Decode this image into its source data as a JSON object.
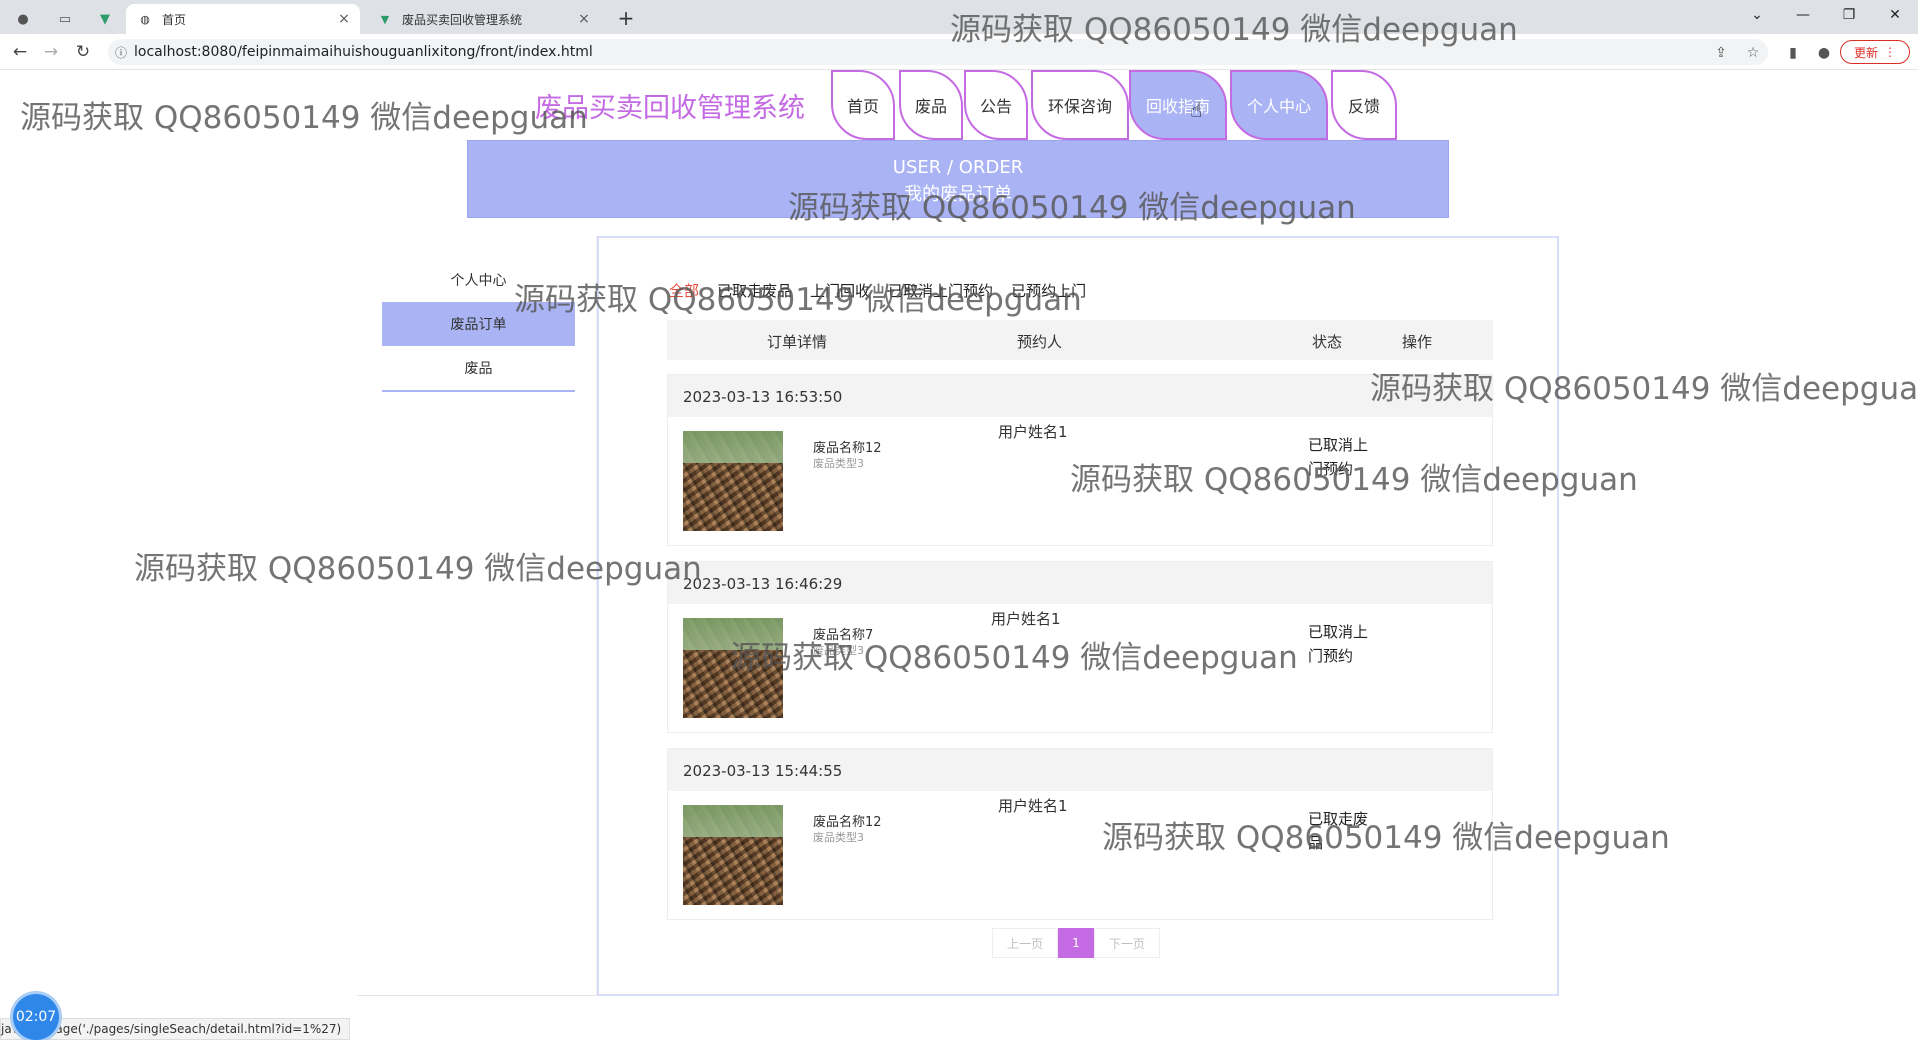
{
  "browser": {
    "tabs": [
      {
        "title": "首页",
        "close": "×"
      },
      {
        "title": "废品买卖回收管理系统",
        "close": "×"
      }
    ],
    "new_tab": "+",
    "url": "localhost:8080/feipinmaimaihuishouguanlixitong/front/index.html",
    "update_label": "更新",
    "status_url": "javascript:navPage('./pages/singleSeach/detail.html?id=1%27)",
    "status_display": "jav  :navPage('./pages/singleSeach/detail.html?id=1%27)"
  },
  "site": {
    "title": "废品买卖回收管理系统",
    "nav": [
      "首页",
      "废品",
      "公告",
      "环保咨询",
      "回收指南",
      "个人中心",
      "反馈"
    ],
    "banner_en": "USER / ORDER",
    "banner_cn": "我的废品订单"
  },
  "sidebar": {
    "items": [
      "个人中心",
      "废品订单",
      "废品"
    ]
  },
  "filters": [
    "全部",
    "已取走废品",
    "上门回收",
    "已取消上门预约",
    "已预约上门"
  ],
  "table": {
    "headers": [
      "订单详情",
      "预约人",
      "状态",
      "操作"
    ]
  },
  "orders": [
    {
      "time": "2023-03-13 16:53:50",
      "name": "废品名称12",
      "type": "废品类型3",
      "user": "用户姓名1",
      "status": "已取消上门预约"
    },
    {
      "time": "2023-03-13 16:46:29",
      "name": "废品名称7",
      "type": "废品类型3",
      "user": "用户姓名1",
      "status": "已取消上门预约"
    },
    {
      "time": "2023-03-13 15:44:55",
      "name": "废品名称12",
      "type": "废品类型3",
      "user": "用户姓名1",
      "status": "已取走废品"
    }
  ],
  "pager": {
    "prev": "上一页",
    "current": "1",
    "next": "下一页"
  },
  "watermark": "源码获取 QQ86050149 微信deepguan",
  "timer": "02:07",
  "colors": {
    "accent": "#c46be3",
    "nav_active": "#aab4f5"
  }
}
